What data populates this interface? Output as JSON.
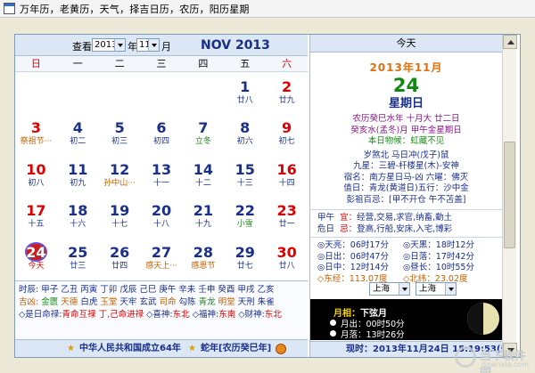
{
  "window": {
    "title": "万年历，老黄历，天气，择吉日历，农历，阳历星期"
  },
  "toolbar": {
    "view_label": "查看",
    "year_value": "2013",
    "year_suffix": "年",
    "month_value": "11",
    "month_suffix": "月",
    "month_title": "NOV 2013"
  },
  "weekdays": [
    "日",
    "一",
    "二",
    "三",
    "四",
    "五",
    "六"
  ],
  "calendar": {
    "weeks": [
      [
        {
          "day": "",
          "sub": "",
          "style": ""
        },
        {
          "day": "",
          "sub": "",
          "style": ""
        },
        {
          "day": "",
          "sub": "",
          "style": ""
        },
        {
          "day": "",
          "sub": "",
          "style": ""
        },
        {
          "day": "",
          "sub": "",
          "style": ""
        },
        {
          "day": "1",
          "sub": "廿八",
          "style": ""
        },
        {
          "day": "2",
          "sub": "廿九",
          "style": ""
        }
      ],
      [
        {
          "day": "3",
          "sub": "祭祖节···",
          "style": "org"
        },
        {
          "day": "4",
          "sub": "初二",
          "style": ""
        },
        {
          "day": "5",
          "sub": "初三",
          "style": ""
        },
        {
          "day": "6",
          "sub": "初四",
          "style": ""
        },
        {
          "day": "7",
          "sub": "立冬",
          "style": "grn"
        },
        {
          "day": "8",
          "sub": "初六",
          "style": ""
        },
        {
          "day": "9",
          "sub": "初七",
          "style": ""
        }
      ],
      [
        {
          "day": "10",
          "sub": "初八",
          "style": ""
        },
        {
          "day": "11",
          "sub": "初九",
          "style": ""
        },
        {
          "day": "12",
          "sub": "孙中山···",
          "style": "org"
        },
        {
          "day": "13",
          "sub": "十一",
          "style": ""
        },
        {
          "day": "14",
          "sub": "十二",
          "style": ""
        },
        {
          "day": "15",
          "sub": "十三",
          "style": ""
        },
        {
          "day": "16",
          "sub": "十四",
          "style": ""
        }
      ],
      [
        {
          "day": "17",
          "sub": "十五",
          "style": ""
        },
        {
          "day": "18",
          "sub": "十六",
          "style": ""
        },
        {
          "day": "19",
          "sub": "十七",
          "style": ""
        },
        {
          "day": "20",
          "sub": "十八",
          "style": ""
        },
        {
          "day": "21",
          "sub": "十九",
          "style": ""
        },
        {
          "day": "22",
          "sub": "小雪",
          "style": "grn"
        },
        {
          "day": "23",
          "sub": "廿一",
          "style": ""
        }
      ],
      [
        {
          "day": "24",
          "sub": "今天",
          "style": "today"
        },
        {
          "day": "25",
          "sub": "廿三",
          "style": ""
        },
        {
          "day": "26",
          "sub": "廿四",
          "style": ""
        },
        {
          "day": "27",
          "sub": "感天上···",
          "style": "org"
        },
        {
          "day": "28",
          "sub": "感恩节",
          "style": "org"
        },
        {
          "day": "29",
          "sub": "廿七",
          "style": ""
        },
        {
          "day": "30",
          "sub": "廿八",
          "style": ""
        }
      ]
    ]
  },
  "info": {
    "shichen_label": "时辰:",
    "shichen": "甲子 乙丑 丙寅 丁卯 戊辰 己巳 庚午 辛未 壬申 癸酉 甲戌 乙亥",
    "jixiong_label": "吉凶:",
    "jixiong": [
      {
        "t": "金匮",
        "c": "g"
      },
      {
        "t": "天德",
        "c": "o"
      },
      {
        "t": "白虎",
        "c": "b"
      },
      {
        "t": "玉堂",
        "c": "o"
      },
      {
        "t": "天牢",
        "c": "b"
      },
      {
        "t": "玄武",
        "c": "b"
      },
      {
        "t": "司命",
        "c": "o"
      },
      {
        "t": "勾陈",
        "c": "b"
      },
      {
        "t": "青龙",
        "c": "g"
      },
      {
        "t": "明堂",
        "c": "o"
      },
      {
        "t": "天刑",
        "c": "b"
      },
      {
        "t": "朱雀",
        "c": "b"
      }
    ],
    "row3_a": "◇是日命禄:",
    "row3_b": "青命互禄",
    "row3_c": "丁,己命进禄",
    "row3_d": "◇喜神:",
    "row3_e": "东北",
    "row3_f": "◇福神:",
    "row3_g": "东南",
    "row3_h": "◇财神:",
    "row3_i": "东北"
  },
  "footer": {
    "left": "中华人民共和国成立64年",
    "right": "蛇年[农历癸巳年]"
  },
  "today_panel": {
    "header": "今天",
    "year_month": "2013年11月",
    "day": "24",
    "weekday": "星期日",
    "lunar": "农历癸巳水年 十月大 廿二日",
    "ganzhi": "癸亥水(孟冬)月 甲午金星期日",
    "wuhou": "本日物候：虹藏不见",
    "suisha": "岁煞北 马日冲(戊子)鼠",
    "jiuxing": "九星：三碧-杆楼星(木)-安神",
    "xiuming": "宿名：南方星日马-凶 六曜：佛灭",
    "zhiri": "值日：青龙(黄道日)五行：沙中金",
    "pengzu": "彭祖百忌：[甲不开仓 午不苫盖]",
    "yi_label": "甲午",
    "yi_key": "宜：",
    "yi": "经营,交易,求官,纳畜,動土",
    "ji_label": "危日",
    "ji_key": "忌：",
    "ji": "登高,行船,安床,入宅,博彩"
  },
  "sun": {
    "rise": "◎天亮：06时17分",
    "dark": "◎天黑：18时12分",
    "sunrise": "◎日出：06时47分",
    "sunset": "◎日落：17时42分",
    "noon": "◎日中：12时14分",
    "daylen": "◎昼长：10时55分",
    "east": "◇东经：113.07度",
    "north": "◇北纬：23.02度"
  },
  "city": {
    "province": "上海",
    "city": "上海"
  },
  "moon": {
    "title_prefix": "月相：",
    "title_phase": "下弦月",
    "rise": "月出：00时50分",
    "set": "月落：13时26分"
  },
  "now": {
    "text": "现时：2013年11月24日 15:19:53(未)"
  },
  "watermark": {
    "name": "当下软件园",
    "url": "downxia.com"
  },
  "colors": {
    "accent": "#1a2f8a",
    "weekend": "#dd0000",
    "jieqi": "#1a8a1a",
    "today_badge": "#c82020"
  }
}
